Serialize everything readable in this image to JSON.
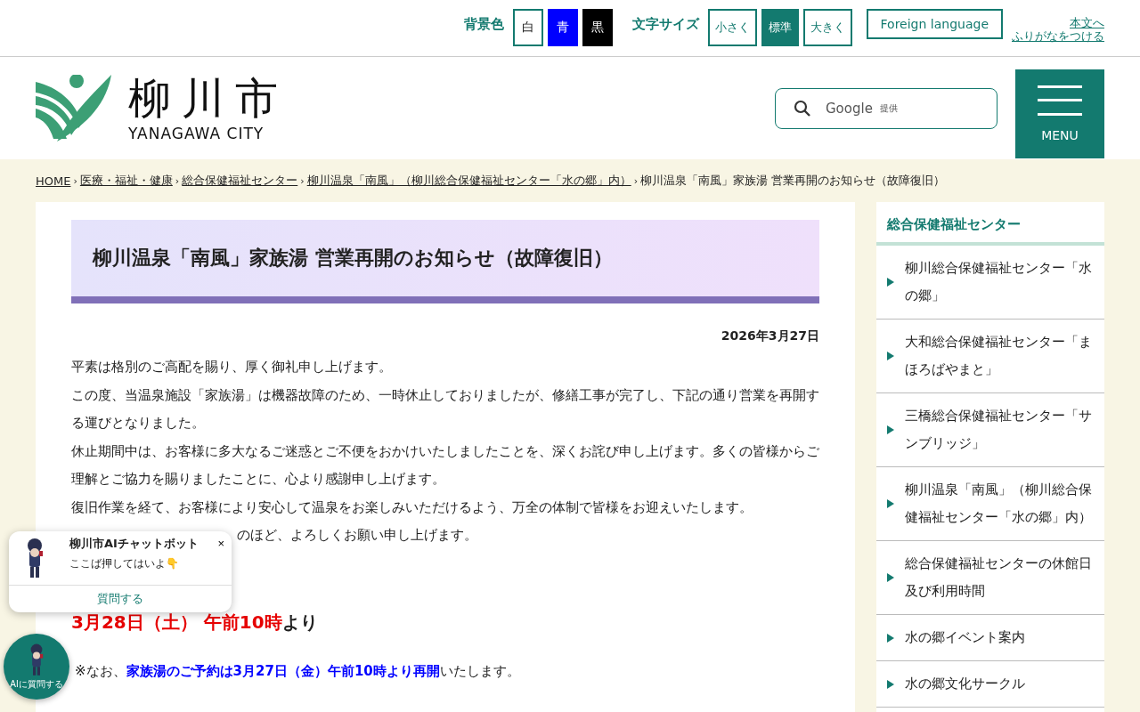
{
  "utility_bar": {
    "background_label": "背景色",
    "background_options": [
      {
        "label": "白",
        "kind": "white"
      },
      {
        "label": "青",
        "kind": "blue"
      },
      {
        "label": "黒",
        "kind": "black"
      }
    ],
    "text_size_label": "文字サイズ",
    "text_sizes": [
      {
        "label": "小さく",
        "selected": false
      },
      {
        "label": "標準",
        "selected": true
      },
      {
        "label": "大きく",
        "selected": false
      }
    ],
    "foreign_language": "Foreign language",
    "skip_link": "本文へ",
    "furigana_link": "ふりがなをつける"
  },
  "header": {
    "logo_text": "柳川市",
    "logo_subtext": "YANAGAWA CITY",
    "search": {
      "placeholder": "Google",
      "placeholder_note": "提供"
    },
    "menu_label": "MENU"
  },
  "breadcrumb_separator": "›",
  "breadcrumb": [
    {
      "label": "HOME",
      "link": true
    },
    {
      "label": "医療・福祉・健康",
      "link": true
    },
    {
      "label": "総合保健福祉センター",
      "link": true
    },
    {
      "label": "柳川温泉「南風」（柳川総合保健福祉センター「水の郷」内）",
      "link": true
    },
    {
      "label": "柳川温泉「南風」家族湯 営業再開のお知らせ（故障復旧）",
      "link": false
    }
  ],
  "article": {
    "title": "柳川温泉「南風」家族湯 営業再開のお知らせ（故障復旧）",
    "date": "2026年3月27日",
    "paragraphs": [
      "平素は格別のご高配を賜り、厚く御礼申し上げます。",
      "この度、当温泉施設「家族湯」は機器故障のため、一時休止しておりましたが、修繕工事が完了し、下記の通り営業を再開する運びとなりました。",
      "休止期間中は、お客様に多大なるご迷惑とご不便をおかけいたしましたことを、深くお詫び申し上げます。多くの皆様からご理解とご協力を賜りましたことに、心より感謝申し上げます。",
      "復旧作業を経て、お客様により安心して温泉をお楽しみいただけるよう、万全の体制で皆様をお迎えいたします。"
    ],
    "partly_hidden_line": "のほど、よろしくお願い申し上げます。",
    "reopening": [
      {
        "text": "3月28日（土） 午前10時",
        "kind": "red"
      },
      {
        "text": "より",
        "kind": "plain"
      }
    ],
    "note": [
      {
        "text": "※なお、",
        "kind": "plain"
      },
      {
        "text": "家族湯のご予約は3月27日（金）午前10時より再開",
        "kind": "blue"
      },
      {
        "text": "いたします。",
        "kind": "plain"
      }
    ]
  },
  "sidebar": {
    "heading": "総合保健福祉センター",
    "items": [
      "柳川総合保健福祉センター「水の郷」",
      "大和総合保健福祉センター「まほろばやまと」",
      "三橋総合保健福祉センター「サンブリッジ」",
      "柳川温泉「南風」（柳川総合保健福祉センター「水の郷」内）",
      "総合保健福祉センターの休館日及び利用時間",
      "水の郷イベント案内",
      "水の郷文化サークル"
    ]
  },
  "chatbot": {
    "title": "柳川市AIチャットボット",
    "message": "ここば押してはいよ👇",
    "close": "×",
    "ask_button": "質問する",
    "launcher_label": "AIに質問する"
  }
}
